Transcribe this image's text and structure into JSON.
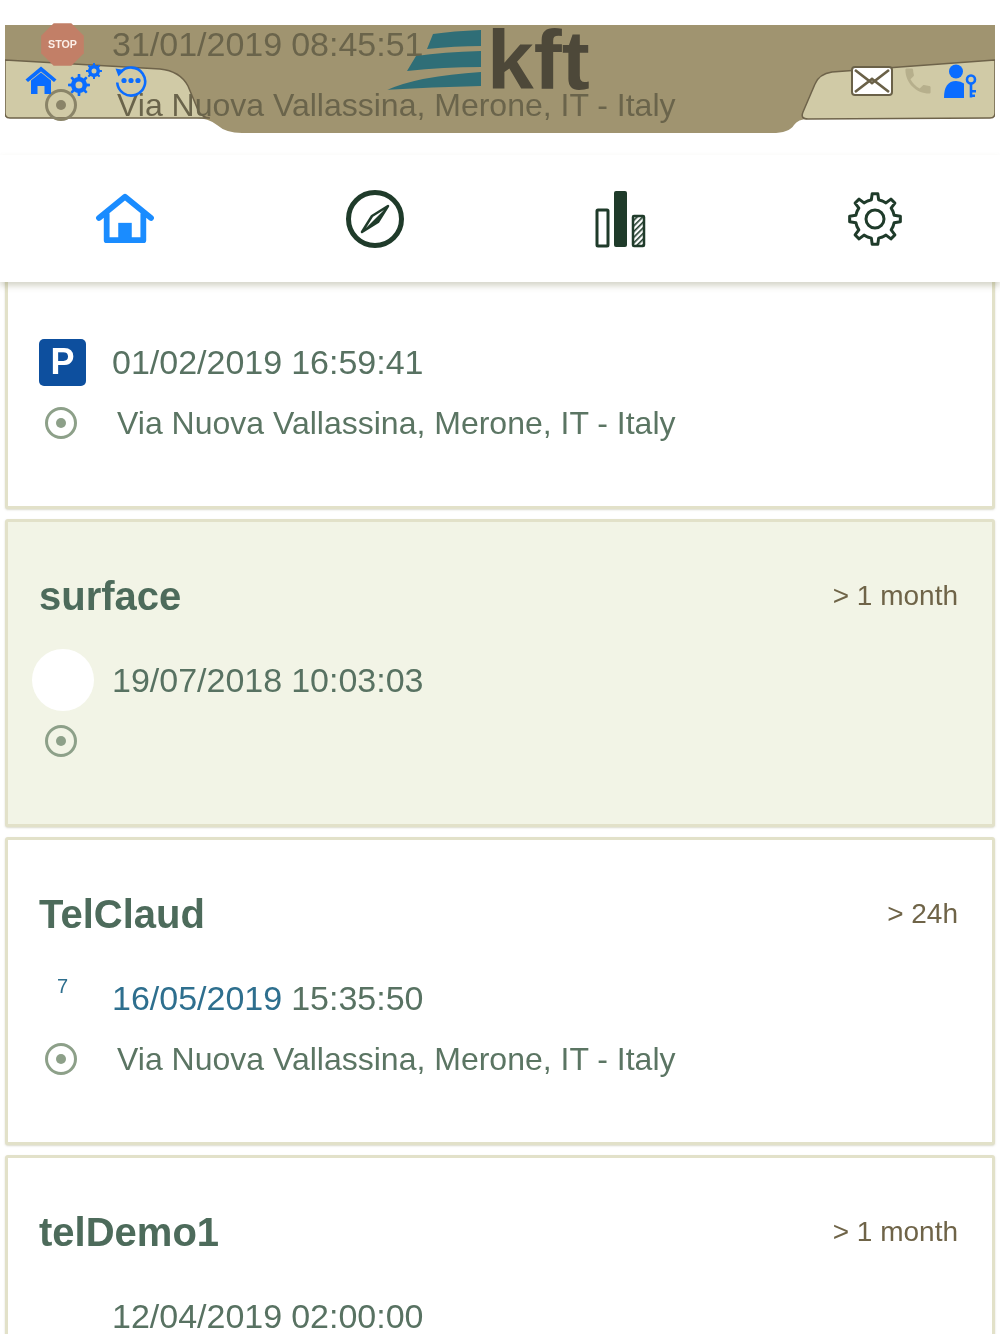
{
  "header": {
    "logo_text": "kft",
    "left_buttons": [
      {
        "kind": "home",
        "disabled": false
      },
      {
        "kind": "settings",
        "disabled": false
      },
      {
        "kind": "refresh",
        "disabled": false
      }
    ],
    "right_buttons": [
      {
        "kind": "mail",
        "disabled": false
      },
      {
        "kind": "phone",
        "disabled": true
      },
      {
        "kind": "user",
        "disabled": false
      }
    ]
  },
  "nav_tabs": [
    {
      "kind": "home",
      "selected": true
    },
    {
      "kind": "compass",
      "selected": false
    },
    {
      "kind": "chart",
      "selected": false
    },
    {
      "kind": "settings",
      "selected": false
    }
  ],
  "devices": [
    {
      "selected": false,
      "status": {
        "kind": "stop",
        "label": "STOP"
      },
      "date": "31/01/2019",
      "time": "08:45:51",
      "date_highlighted": false,
      "location_shown": true,
      "address": "Via Nuova Vallassina, Merone, IT - Italy"
    },
    {
      "selected": false,
      "status": {
        "kind": "parking",
        "label": "P"
      },
      "date": "01/02/2019",
      "time": "16:59:41",
      "date_highlighted": false,
      "location_shown": true,
      "address": "Via Nuova Vallassina, Merone, IT - Italy"
    },
    {
      "name": "surface",
      "age": "> 1 month",
      "selected": true,
      "status": {
        "kind": "circle"
      },
      "date": "19/07/2018",
      "time": "10:03:03",
      "date_highlighted": false,
      "location_shown": true
    },
    {
      "name": "TelClaud",
      "age": "> 24h",
      "selected": false,
      "status": {
        "kind": "count",
        "label": "7"
      },
      "date": "16/05/2019",
      "time": "15:35:50",
      "date_highlighted": true,
      "location_shown": true,
      "address": "Via Nuova Vallassina, Merone, IT - Italy"
    },
    {
      "name": "telDemo1",
      "age": "> 1 month",
      "selected": false,
      "date": "12/04/2019",
      "time": "02:00:00",
      "date_highlighted": false,
      "location_shown": false
    }
  ]
}
